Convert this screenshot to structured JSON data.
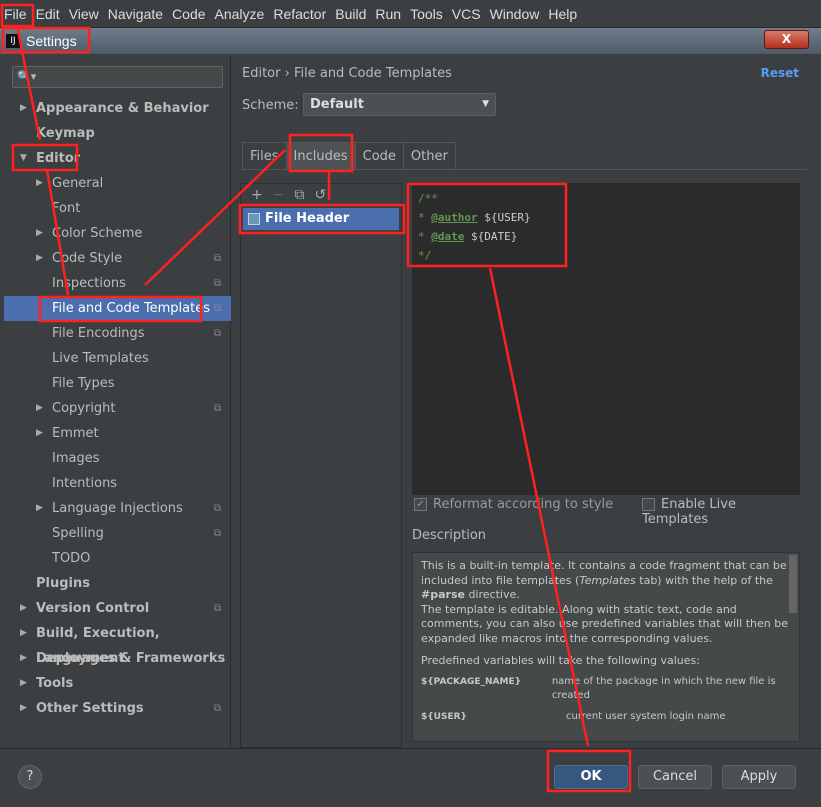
{
  "menu": [
    "File",
    "Edit",
    "View",
    "Navigate",
    "Code",
    "Analyze",
    "Refactor",
    "Build",
    "Run",
    "Tools",
    "VCS",
    "Window",
    "Help"
  ],
  "window": {
    "title": "Settings",
    "logo": "IJ",
    "close": "X"
  },
  "search": {
    "icon": "search-icon",
    "value": ""
  },
  "tree": [
    {
      "label": "Appearance & Behavior",
      "level": 0,
      "bold": true,
      "arrow": "right"
    },
    {
      "label": "Keymap",
      "level": 0,
      "bold": true
    },
    {
      "label": "Editor",
      "level": 0,
      "bold": true,
      "arrow": "down"
    },
    {
      "label": "General",
      "level": 1,
      "arrow": "right"
    },
    {
      "label": "Font",
      "level": 1
    },
    {
      "label": "Color Scheme",
      "level": 1,
      "arrow": "right"
    },
    {
      "label": "Code Style",
      "level": 1,
      "arrow": "right",
      "copy": true
    },
    {
      "label": "Inspections",
      "level": 1,
      "copy": true
    },
    {
      "label": "File and Code Templates",
      "level": 1,
      "copy": true,
      "selected": true
    },
    {
      "label": "File Encodings",
      "level": 1,
      "copy": true
    },
    {
      "label": "Live Templates",
      "level": 1
    },
    {
      "label": "File Types",
      "level": 1
    },
    {
      "label": "Copyright",
      "level": 1,
      "arrow": "right",
      "copy": true
    },
    {
      "label": "Emmet",
      "level": 1,
      "arrow": "right"
    },
    {
      "label": "Images",
      "level": 1
    },
    {
      "label": "Intentions",
      "level": 1
    },
    {
      "label": "Language Injections",
      "level": 1,
      "arrow": "right",
      "copy": true
    },
    {
      "label": "Spelling",
      "level": 1,
      "copy": true
    },
    {
      "label": "TODO",
      "level": 1
    },
    {
      "label": "Plugins",
      "level": 0,
      "bold": true
    },
    {
      "label": "Version Control",
      "level": 0,
      "bold": true,
      "arrow": "right",
      "copy": true
    },
    {
      "label": "Build, Execution, Deployment",
      "level": 0,
      "bold": true,
      "arrow": "right"
    },
    {
      "label": "Languages & Frameworks",
      "level": 0,
      "bold": true,
      "arrow": "right"
    },
    {
      "label": "Tools",
      "level": 0,
      "bold": true,
      "arrow": "right"
    },
    {
      "label": "Other Settings",
      "level": 0,
      "bold": true,
      "arrow": "right",
      "copy": true
    }
  ],
  "breadcrumb": {
    "parent": "Editor",
    "sep": "›",
    "current": "File and Code Templates"
  },
  "reset": "Reset",
  "scheme": {
    "label": "Scheme:",
    "value": "Default"
  },
  "tabs": [
    {
      "label": "Files"
    },
    {
      "label": "Includes",
      "active": true
    },
    {
      "label": "Code"
    },
    {
      "label": "Other"
    }
  ],
  "list_tools": [
    "+",
    "−",
    "⧉",
    "↺"
  ],
  "list_items": [
    "File Header"
  ],
  "editor": {
    "l1": "/**",
    "star": "*",
    "author_tag": "@author",
    "author_var": "${USER}",
    "date_tag": "@date",
    "date_var": "${DATE}",
    "end": "*/"
  },
  "options": {
    "reformat": "Reformat according to style",
    "reformat_checked": true,
    "live": "Enable Live Templates",
    "live_checked": false
  },
  "description": {
    "label": "Description",
    "p1a": "This is a built-in template. It contains a code fragment that can be included into file templates (",
    "p1em": "Templates",
    "p1b": " tab) with the help of the ",
    "p1bold": "#parse",
    "p1c": " directive.",
    "p2": "The template is editable. Along with static text, code and comments, you can also use predefined variables that will then be expanded like macros into the corresponding values.",
    "p3": "Predefined variables will take the following values:",
    "vars": [
      {
        "name": "${PACKAGE_NAME}",
        "desc": "name of the package in which the new file is created"
      },
      {
        "name": "${USER}",
        "desc": "current user system login name"
      }
    ]
  },
  "buttons": {
    "help": "?",
    "ok": "OK",
    "cancel": "Cancel",
    "apply": "Apply"
  },
  "colors": {
    "annotation": "#ff2020",
    "selection": "#4b6eaf",
    "link": "#589df6"
  }
}
